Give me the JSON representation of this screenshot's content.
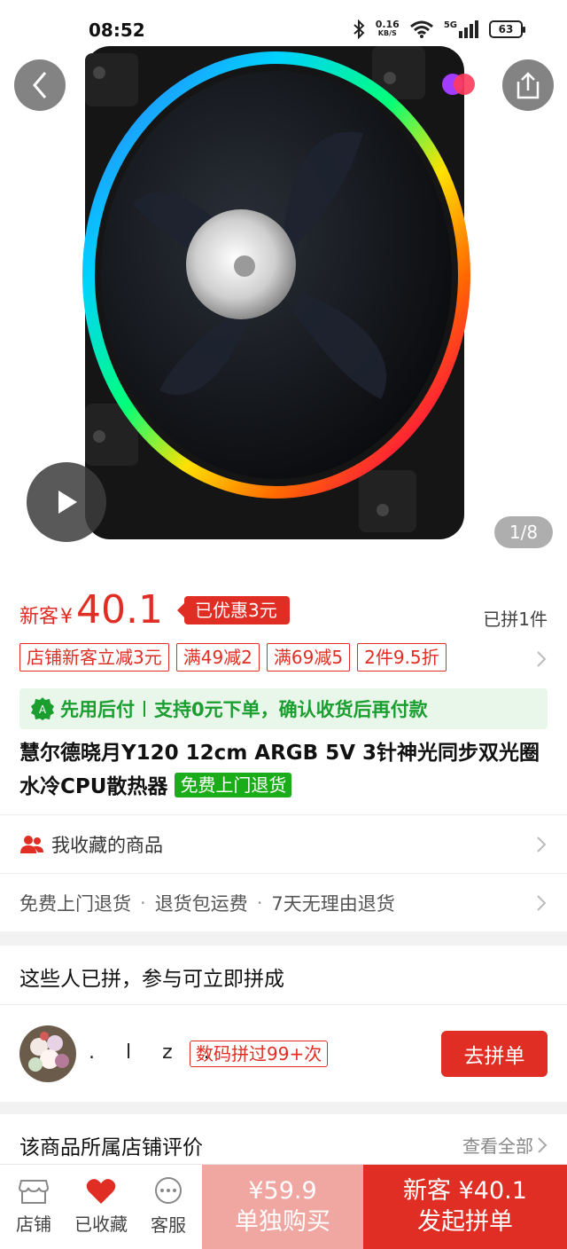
{
  "status_bar": {
    "time": "08:52",
    "net_speed_value": "0.16",
    "net_speed_unit": "KB/S",
    "signal": "5G",
    "battery": "63"
  },
  "gallery": {
    "page_indicator": "1/8"
  },
  "price": {
    "new_label": "新客",
    "currency": "¥",
    "amount": "40.1",
    "discount_tag": "已优惠3元",
    "sold": "已拼1件"
  },
  "coupons": [
    "店铺新客立减3元",
    "满49减2",
    "满69减5",
    "2件9.5折"
  ],
  "pay_later": {
    "title": "先用后付",
    "desc": "支持0元下单，确认收货后再付款"
  },
  "product": {
    "title": "慧尔德晓月Y120 12cm ARGB 5V 3针神光同步双光圈水冷CPU散热器",
    "badge": "免费上门退货"
  },
  "favorites_row": {
    "label": "我收藏的商品"
  },
  "services": [
    "免费上门退货",
    "退货包运费",
    "7天无理由退货"
  ],
  "group_buy": {
    "heading": "这些人已拼，参与可立即拼成",
    "user_name": ". l z .",
    "user_badge": "数码拼过99+次",
    "join_label": "去拼单"
  },
  "reviews": {
    "title": "该商品所属店铺评价",
    "view_all": "查看全部"
  },
  "bottom_bar": {
    "store": "店铺",
    "favorited": "已收藏",
    "service": "客服",
    "alone_price": "¥59.9",
    "alone_label": "单独购买",
    "group_price": "新客 ¥40.1",
    "group_label": "发起拼单"
  },
  "colors": {
    "accent": "#e02e24",
    "green": "#1a9e2f",
    "alone_bg": "#f0a6a1"
  }
}
